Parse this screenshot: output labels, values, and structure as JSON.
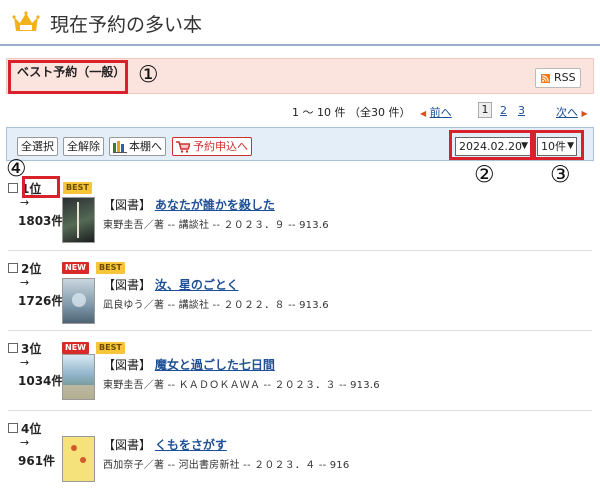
{
  "header": {
    "title": "現在予約の多い本",
    "icon": "crown-icon"
  },
  "category": {
    "label": "ベスト予約（一般）",
    "rss_label": "RSS"
  },
  "annotations": {
    "a1": "①",
    "a2": "②",
    "a3": "③",
    "a4": "④"
  },
  "pagination": {
    "summary": "1 ～ 10 件 （全30 件）",
    "prev": "前へ",
    "pages": [
      "1",
      "2",
      "3"
    ],
    "next": "次へ"
  },
  "toolbar": {
    "select_all": "全選択",
    "deselect_all": "全解除",
    "bookshelf": "本棚へ",
    "reserve": "予約申込へ",
    "date_value": "2024.02.20",
    "per_page_value": "10件"
  },
  "items": [
    {
      "rank": "1位",
      "arrow": "→",
      "count": "1803件",
      "badges": [
        "BEST"
      ],
      "type": "【図書】",
      "title": "あなたが誰かを殺した",
      "meta": "東野圭吾／著 -- 講談社 -- ２０２３．９ -- 913.6"
    },
    {
      "rank": "2位",
      "arrow": "→",
      "count": "1726件",
      "badges": [
        "NEW",
        "BEST"
      ],
      "type": "【図書】",
      "title": "汝、星のごとく",
      "meta": "凪良ゆう／著 -- 講談社 -- ２０２２．８ -- 913.6"
    },
    {
      "rank": "3位",
      "arrow": "→",
      "count": "1034件",
      "badges": [
        "NEW",
        "BEST"
      ],
      "type": "【図書】",
      "title": "魔女と過ごした七日間",
      "meta": "東野圭吾／著 -- ＫＡＤＯＫＡＷＡ -- ２０２３．３ -- 913.6"
    },
    {
      "rank": "4位",
      "arrow": "→",
      "count": "961件",
      "badges": [],
      "type": "【図書】",
      "title": "くもをさがす",
      "meta": "西加奈子／著 -- 河出書房新社 -- ２０２３．４ -- 916"
    }
  ],
  "colors": {
    "accent_red": "#d8212a",
    "link_blue": "#1f4f96",
    "category_bg": "#fbe3de",
    "toolbar_bg": "#e3eef9"
  }
}
